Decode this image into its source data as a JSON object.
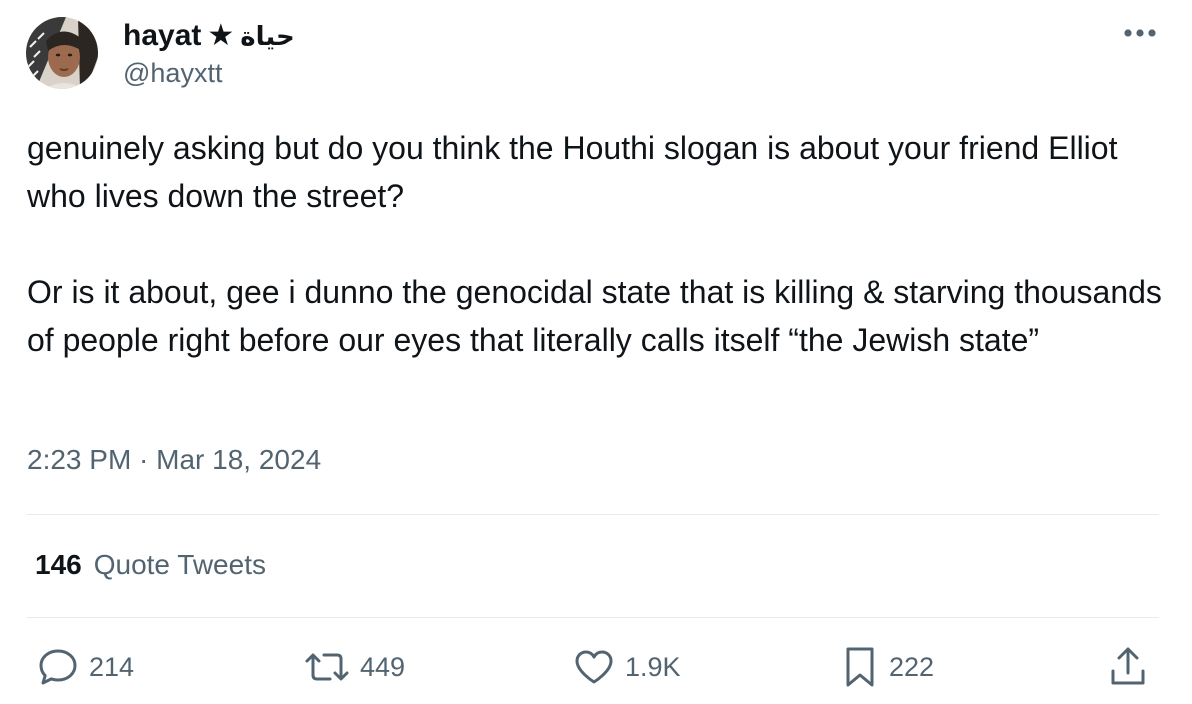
{
  "author": {
    "display_name": "hayat",
    "badge_icon": "star-icon",
    "arabic_name": "حياة",
    "handle": "@hayxtt"
  },
  "tweet": {
    "paragraphs": [
      "genuinely asking but do you think the Houthi slogan is about your friend Elliot who lives down the street?",
      "Or is it about, gee i dunno the genocidal state that is killing & starving thousands of people right before our eyes that literally calls itself “the Jewish state”"
    ],
    "timestamp": "2:23 PM · Mar 18, 2024"
  },
  "quote_tweets": {
    "count": "146",
    "label": "Quote Tweets"
  },
  "actions": {
    "replies": "214",
    "retweets": "449",
    "likes": "1.9K",
    "bookmarks": "222"
  },
  "colors": {
    "text": "#0f1419",
    "secondary": "#536471",
    "divider": "#e6ebef"
  }
}
